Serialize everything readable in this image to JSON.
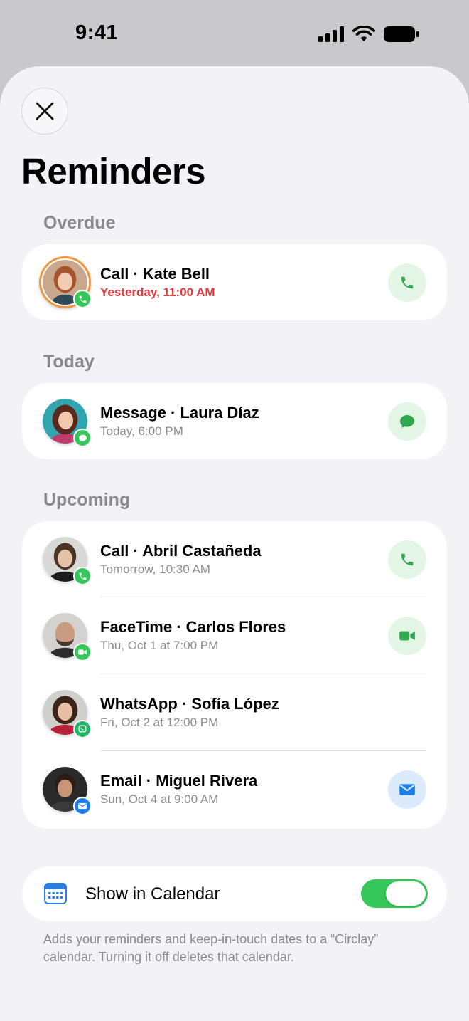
{
  "status_bar": {
    "time": "9:41"
  },
  "header": {
    "close_icon": "close-icon",
    "title": "Reminders"
  },
  "sections": {
    "overdue": {
      "label": "Overdue",
      "items": [
        {
          "title": "Call · Kate Bell",
          "subtitle": "Yesterday, 11:00 AM",
          "badge": "phone-icon",
          "action": "phone-icon"
        }
      ]
    },
    "today": {
      "label": "Today",
      "items": [
        {
          "title": "Message · Laura Díaz",
          "subtitle": "Today, 6:00 PM",
          "badge": "message-icon",
          "action": "message-icon"
        }
      ]
    },
    "upcoming": {
      "label": "Upcoming",
      "items": [
        {
          "title": "Call · Abril Castañeda",
          "subtitle": "Tomorrow, 10:30 AM",
          "badge": "phone-icon",
          "action": "phone-icon"
        },
        {
          "title": "FaceTime · Carlos Flores",
          "subtitle": "Thu, Oct 1 at 7:00 PM",
          "badge": "video-icon",
          "action": "video-icon"
        },
        {
          "title": "WhatsApp · Sofía López",
          "subtitle": "Fri, Oct 2 at 12:00 PM",
          "badge": "whatsapp-icon",
          "action": ""
        },
        {
          "title": "Email · Miguel Rivera",
          "subtitle": "Sun, Oct 4 at 9:00 AM",
          "badge": "mail-icon",
          "action": "mail-icon"
        }
      ]
    }
  },
  "calendar": {
    "label": "Show in Calendar",
    "icon": "calendar-icon",
    "enabled": true,
    "footnote": "Adds your reminders and keep-in-touch dates to a “Circlay” calendar. Turning it off deletes that calendar."
  },
  "colors": {
    "accent_green": "#34c759",
    "overdue_red": "#e5383b",
    "overdue_ring": "#f0963c",
    "email_blue": "#1a7fe8"
  }
}
